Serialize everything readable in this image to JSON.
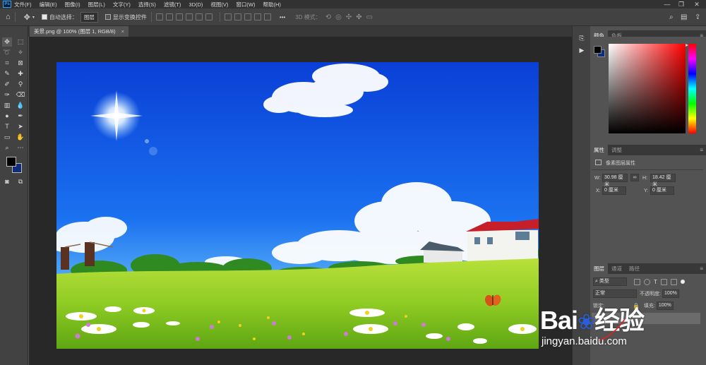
{
  "menubar": {
    "logo": "Ps",
    "items": [
      "文件(F)",
      "编辑(E)",
      "图像(I)",
      "图层(L)",
      "文字(Y)",
      "选择(S)",
      "滤镜(T)",
      "3D(D)",
      "视图(V)",
      "窗口(W)",
      "帮助(H)"
    ],
    "minimize": "—",
    "restore": "❐",
    "close": "✕"
  },
  "options": {
    "home_icon": "home-icon",
    "autoselect_label": "自动选择：",
    "autoselect_value": "图层",
    "transform_label": "显示变换控件",
    "more": "•••",
    "mode3d_label": "3D 模式："
  },
  "document": {
    "tab_title": "美景.png @ 100% (图层 1, RGB/8)",
    "tab_close": "×"
  },
  "colors": {
    "foreground": "#000000",
    "background": "#0f2d7a",
    "accent": "#31a8ff"
  },
  "color_panel": {
    "tabs": [
      "颜色",
      "色板"
    ]
  },
  "properties_panel": {
    "tabs": [
      "属性",
      "调整"
    ],
    "section_title": "像素图层属性",
    "w_label": "W:",
    "w_value": "30.98 厘米",
    "h_label": "H:",
    "h_value": "18.42 厘米",
    "x_label": "X:",
    "x_value": "0 厘米",
    "y_label": "Y:",
    "y_value": "0 厘米",
    "link_icon": "∞"
  },
  "layers_panel": {
    "tabs": [
      "图层",
      "通道",
      "路径"
    ],
    "filter_label": "类型",
    "blend_mode": "正常",
    "opacity_label": "不透明度:",
    "opacity_value": "100%",
    "lock_label": "锁定:",
    "fill_label": "填充:",
    "fill_value": "100%"
  },
  "watermark": {
    "brand": "Bai",
    "brand_cn": "经验",
    "url": "jingyan.baidu.com"
  }
}
